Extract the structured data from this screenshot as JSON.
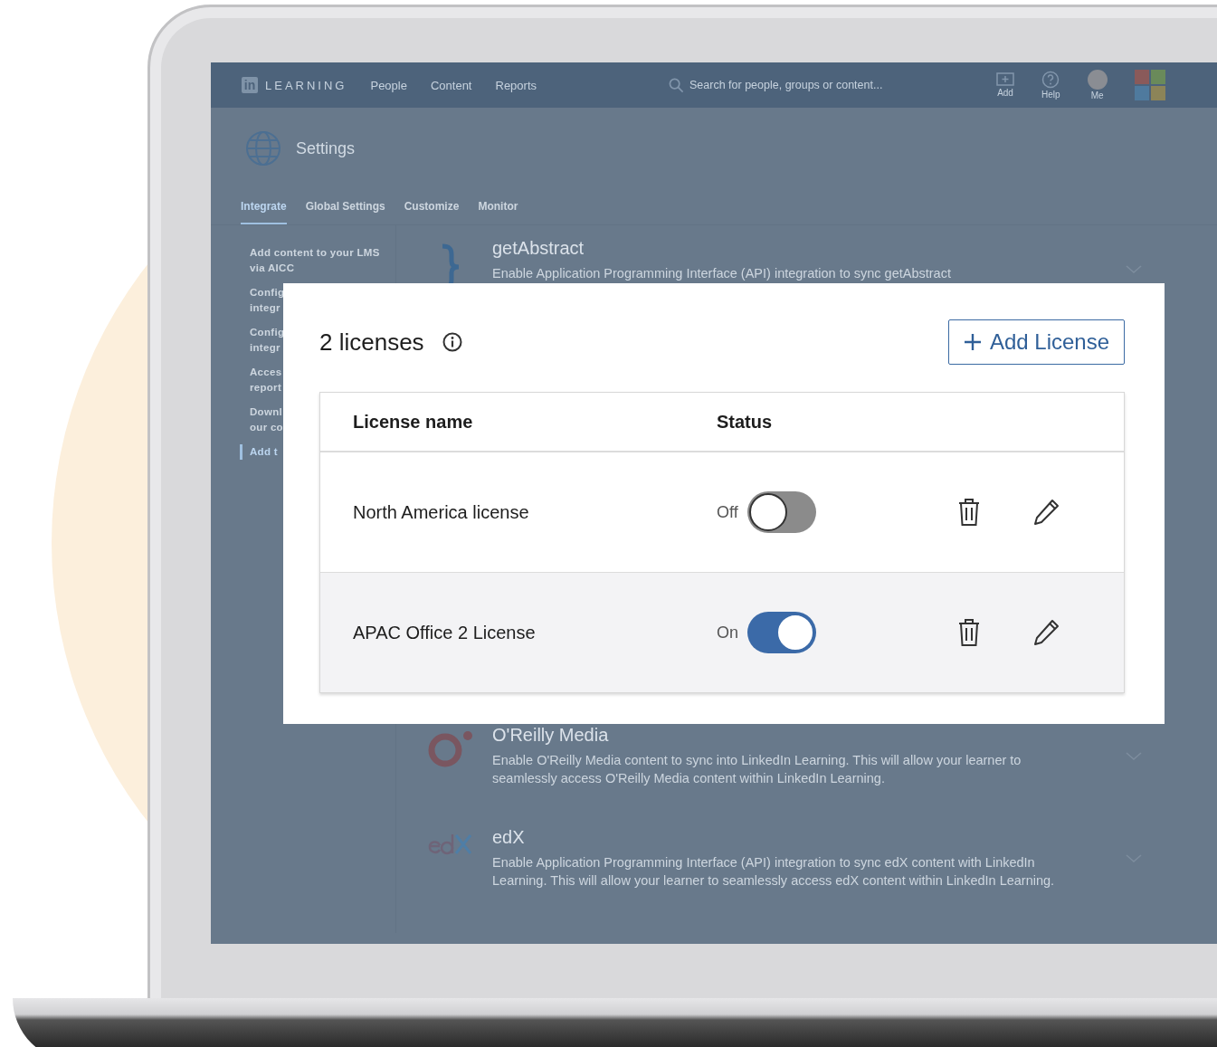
{
  "navbar": {
    "logo_mark": "in",
    "logo_text": "LEARNING",
    "links": [
      "People",
      "Content",
      "Reports"
    ],
    "search": {
      "placeholder": "Search for people, groups or content..."
    },
    "actions": [
      {
        "kind": "add",
        "label": "Add"
      },
      {
        "kind": "help",
        "label": "Help"
      },
      {
        "kind": "avatar",
        "label": "Me"
      },
      {
        "kind": "apps"
      }
    ]
  },
  "page": {
    "title": "Settings"
  },
  "tabs": [
    {
      "label": "Integrate",
      "selected": true
    },
    {
      "label": "Global Settings",
      "selected": false
    },
    {
      "label": "Customize",
      "selected": false
    },
    {
      "label": "Monitor",
      "selected": false
    }
  ],
  "sidebar": {
    "items": [
      {
        "lines": [
          "Add content to your LMS",
          "via AICC"
        ],
        "selected": false
      },
      {
        "lines": [
          "Config",
          "integr"
        ],
        "selected": false
      },
      {
        "lines": [
          "Config",
          "integr"
        ],
        "selected": false
      },
      {
        "lines": [
          "Acces",
          "report"
        ],
        "selected": false
      },
      {
        "lines": [
          "Downl",
          "our co"
        ],
        "selected": false
      },
      {
        "lines": [
          "Add t"
        ],
        "selected": true
      }
    ]
  },
  "integrations": [
    {
      "kind": "brace",
      "name": "getAbstract",
      "description": "Enable Application Programming Interface (API) integration to sync getAbstract"
    },
    {
      "kind": "ring",
      "name": "O'Reilly Media",
      "description": "Enable O'Reilly Media content to sync into LinkedIn Learning. This will allow your learner to seamlessly access O'Reilly Media content within LinkedIn Learning."
    },
    {
      "kind": "edx",
      "name": "edX",
      "description": "Enable Application Programming Interface (API) integration to sync edX content with LinkedIn Learning. This will allow your learner to seamlessly access edX content within LinkedIn Learning."
    }
  ],
  "dialog": {
    "title": "2 licenses",
    "add_button": "Add License",
    "columns": [
      "License name",
      "Status"
    ],
    "rows": [
      {
        "name": "North America license",
        "status": "Off",
        "on": false,
        "selected": false
      },
      {
        "name": "APAC Office 2 License",
        "status": "On",
        "on": true,
        "selected": true
      }
    ]
  }
}
